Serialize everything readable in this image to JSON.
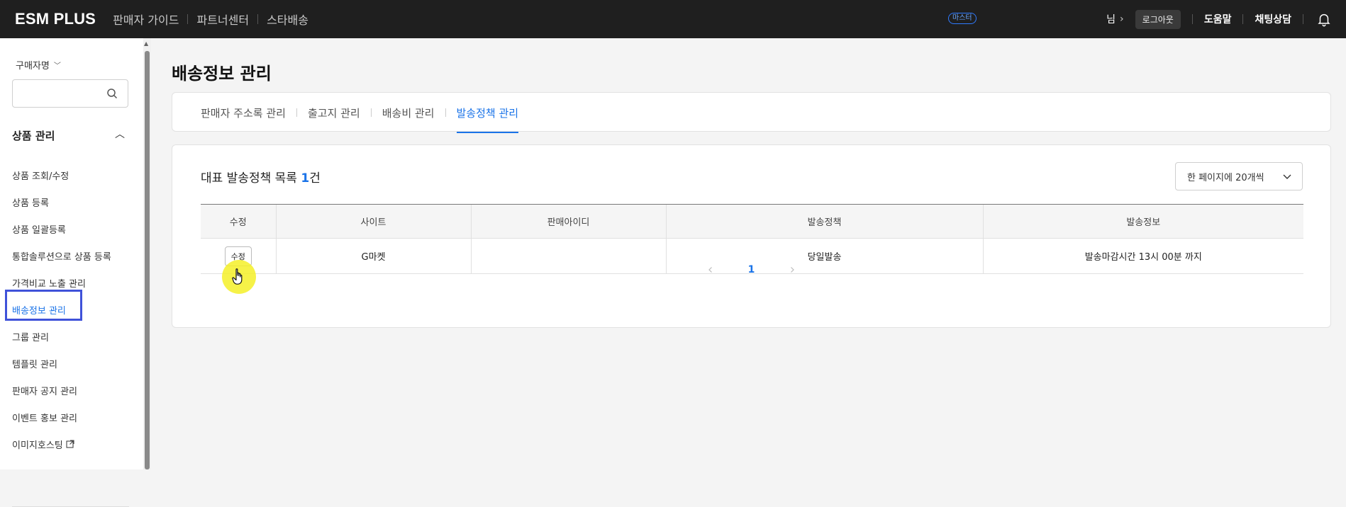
{
  "topbar": {
    "logo": "ESM PLUS",
    "nav": [
      "판매자 가이드",
      "파트너센터",
      "스타배송"
    ],
    "badge": "마스터",
    "user_label": "님",
    "logout": "로그아웃",
    "help": "도움말",
    "chat": "채팅상담",
    "bell_icon": "bell-icon"
  },
  "sidebar": {
    "buyer_name": "구매자명",
    "search_placeholder": "",
    "section_title": "상품 관리",
    "items": [
      {
        "label": "상품 조회/수정"
      },
      {
        "label": "상품 등록"
      },
      {
        "label": "상품 일괄등록"
      },
      {
        "label": "통합솔루션으로 상품 등록"
      },
      {
        "label": "가격비교 노출 관리"
      },
      {
        "label": "배송정보 관리",
        "active": true
      },
      {
        "label": "그룹 관리"
      },
      {
        "label": "템플릿 관리"
      },
      {
        "label": "판매자 공지 관리"
      },
      {
        "label": "이벤트 홍보 관리"
      },
      {
        "label": "이미지호스팅",
        "external": true
      }
    ]
  },
  "main": {
    "title": "배송정보 관리",
    "tabs": [
      {
        "label": "판매자 주소록 관리"
      },
      {
        "label": "출고지 관리"
      },
      {
        "label": "배송비 관리"
      },
      {
        "label": "발송정책 관리",
        "active": true
      }
    ],
    "list": {
      "title_prefix": "대표 발송정책 목록",
      "count": "1",
      "unit": "건",
      "page_size": "한 페이지에 20개씩",
      "columns": [
        "수정",
        "사이트",
        "판매아이디",
        "발송정책",
        "발송정보"
      ],
      "rows": [
        {
          "edit": "수정",
          "site": "G마켓",
          "seller_id": "",
          "policy": "당일발송",
          "info": "발송마감시간 13시 00분 까지"
        }
      ],
      "current_page": "1"
    }
  },
  "colors": {
    "accent": "#1a73e8",
    "topbar_bg": "#1f1f1f",
    "highlight_box": "#3f52d9",
    "cursor_halo": "#f5f028"
  }
}
